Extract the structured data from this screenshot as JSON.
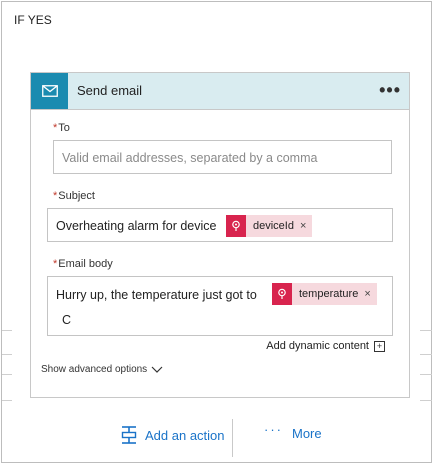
{
  "branch": {
    "title": "IF YES"
  },
  "action_card": {
    "title": "Send email",
    "icon": "mail-icon",
    "menu_label": "•••",
    "accent_color": "#1b8bb0",
    "header_bg": "#d9ecf0"
  },
  "fields": {
    "to": {
      "label": "To",
      "required_mark": "*",
      "value": "",
      "placeholder": "Valid email addresses, separated by a comma"
    },
    "subject": {
      "label": "Subject",
      "required_mark": "*",
      "text": "Overheating alarm for device",
      "token": {
        "label": "deviceId",
        "icon": "pin-icon",
        "remove": "×"
      }
    },
    "body": {
      "label": "Email body",
      "required_mark": "*",
      "text": "Hurry up, the temperature just got to",
      "token": {
        "label": "temperature",
        "icon": "pin-icon",
        "remove": "×"
      },
      "text_after": "C"
    }
  },
  "add_dynamic_content": {
    "label": "Add dynamic content",
    "icon": "plus-box-icon"
  },
  "show_advanced": {
    "label": "Show advanced options",
    "icon": "chevron-down-icon"
  },
  "actions": {
    "add_action": {
      "label": "Add an action",
      "icon": "add-action-icon"
    },
    "more": {
      "label": "More",
      "dots": "···"
    }
  },
  "colors": {
    "link": "#1a73c8",
    "token_bg": "#f6d9de",
    "token_icon": "#d8244e",
    "required": "#c0392b"
  }
}
